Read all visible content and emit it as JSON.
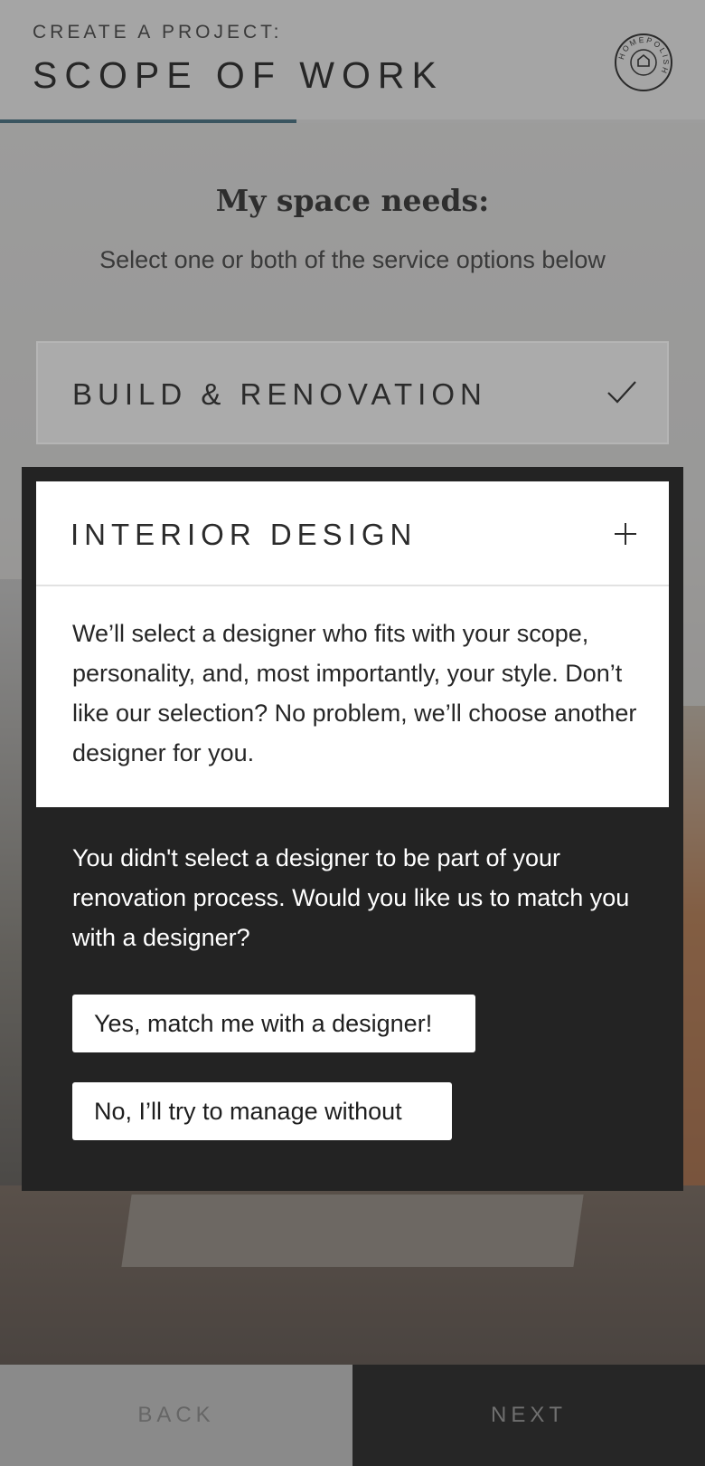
{
  "header": {
    "eyebrow": "CREATE A PROJECT:",
    "title": "SCOPE OF WORK",
    "logo_text": "HOMEPOLISH",
    "progress": 0.42
  },
  "intro": {
    "title": "My space needs:",
    "subtitle": "Select one or both of the service options below"
  },
  "options": [
    {
      "label": "BUILD & RENOVATION",
      "selected": true,
      "icon": "checkmark-icon"
    },
    {
      "label": "INTERIOR DESIGN",
      "selected": false,
      "icon": "plus-icon",
      "description": "We’ll select a designer who fits with your scope, personality, and, most importantly, your style. Don’t like our selection? No problem, we’ll choose another designer for you."
    }
  ],
  "modal": {
    "prompt": "You didn't select a designer to be part of your renovation process. Would you like us to match you with a designer?",
    "yes_label": "Yes, match me with a designer!",
    "no_label": "No, I’ll try to manage without"
  },
  "footer": {
    "back_label": "BACK",
    "next_label": "NEXT"
  },
  "colors": {
    "accent": "#3a5560",
    "modal_bg": "#232323",
    "footer_next_bg": "#262626"
  }
}
